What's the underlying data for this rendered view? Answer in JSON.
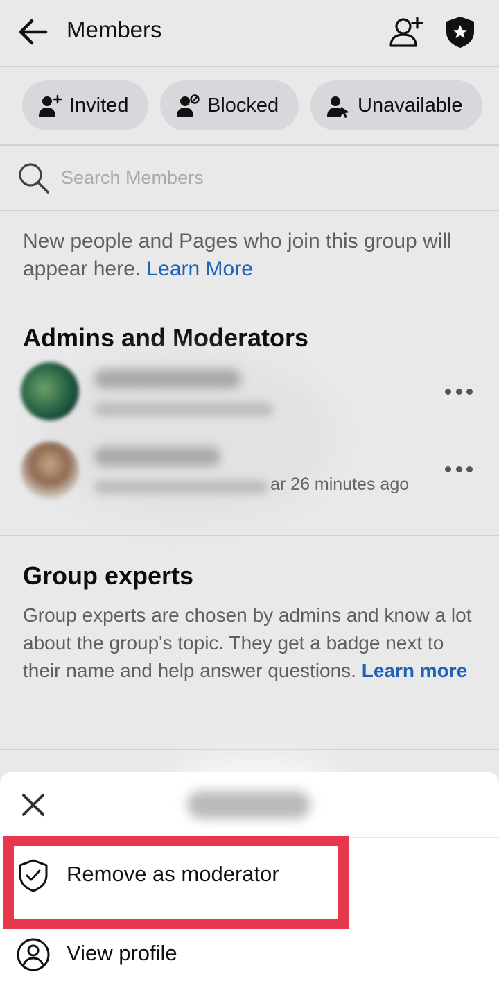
{
  "header": {
    "title": "Members",
    "back_icon": "arrow-left-icon",
    "add_member_icon": "person-add-icon",
    "admin_icon": "shield-star-icon"
  },
  "filters": [
    {
      "label": "Invited",
      "icon": "person-invited-icon"
    },
    {
      "label": "Blocked",
      "icon": "person-blocked-icon"
    },
    {
      "label": "Unavailable",
      "icon": "person-unavailable-icon"
    }
  ],
  "search": {
    "placeholder": "Search Members",
    "icon": "search-icon"
  },
  "info": {
    "text": "New people and Pages who join this group will appear here. ",
    "link": "Learn More"
  },
  "admins": {
    "title": "Admins and Moderators",
    "members": [
      {
        "time_text": ""
      },
      {
        "time_text": "ar 26 minutes ago"
      }
    ]
  },
  "experts": {
    "title": "Group experts",
    "text": "Group experts are chosen by admins and know a lot about the group's topic. They get a badge next to their name and help answer questions. ",
    "link": "Learn more"
  },
  "sheet": {
    "close_icon": "close-icon",
    "items": [
      {
        "label": "Remove as moderator",
        "icon": "shield-check-icon"
      },
      {
        "label": "View profile",
        "icon": "person-circle-icon"
      }
    ]
  },
  "colors": {
    "background": "#e9e9ea",
    "link": "#1f63b8",
    "highlight": "#e8384e",
    "chip": "#d6d8dc"
  }
}
